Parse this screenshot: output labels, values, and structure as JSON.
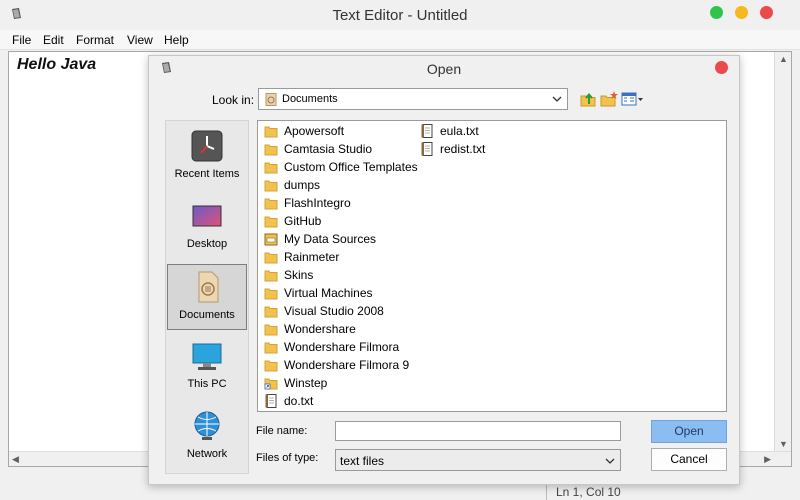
{
  "window": {
    "title": "Text Editor - Untitled"
  },
  "menu": [
    "File",
    "Edit",
    "Format",
    "View",
    "Help"
  ],
  "editor": {
    "content": "Hello Java"
  },
  "statusbar": {
    "text": "Ln 1, Col 10"
  },
  "dialog": {
    "title": "Open",
    "look_in_label": "Look in:",
    "look_in_value": "Documents",
    "places": [
      {
        "label": "Recent Items",
        "icon": "recent-items-icon",
        "selected": false
      },
      {
        "label": "Desktop",
        "icon": "desktop-icon",
        "selected": false
      },
      {
        "label": "Documents",
        "icon": "documents-icon",
        "selected": true
      },
      {
        "label": "This PC",
        "icon": "computer-icon",
        "selected": false
      },
      {
        "label": "Network",
        "icon": "network-icon",
        "selected": false
      }
    ],
    "files_col1": [
      {
        "name": "Apowersoft",
        "type": "folder"
      },
      {
        "name": "Camtasia Studio",
        "type": "folder"
      },
      {
        "name": "Custom Office Templates",
        "type": "folder"
      },
      {
        "name": "dumps",
        "type": "folder"
      },
      {
        "name": "FlashIntegro",
        "type": "folder"
      },
      {
        "name": "GitHub",
        "type": "folder"
      },
      {
        "name": "My Data Sources",
        "type": "datasource"
      },
      {
        "name": "Rainmeter",
        "type": "folder"
      },
      {
        "name": "Skins",
        "type": "folder"
      },
      {
        "name": "Virtual Machines",
        "type": "folder"
      },
      {
        "name": "Visual Studio 2008",
        "type": "folder"
      },
      {
        "name": "Wondershare",
        "type": "folder"
      },
      {
        "name": "Wondershare Filmora",
        "type": "folder"
      },
      {
        "name": "Wondershare Filmora 9",
        "type": "folder"
      },
      {
        "name": "Winstep",
        "type": "shortcut-folder"
      },
      {
        "name": "do.txt",
        "type": "text"
      }
    ],
    "files_col2": [
      {
        "name": "eula.txt",
        "type": "text"
      },
      {
        "name": "redist.txt",
        "type": "text"
      }
    ],
    "file_name_label": "File name:",
    "file_name_value": "",
    "file_type_label": "Files of type:",
    "file_type_value": "text files",
    "open_button": "Open",
    "cancel_button": "Cancel"
  },
  "colors": {
    "folder": "#f2c14e",
    "open_button": "#8bbcf2",
    "close_red": "#ec4a4a",
    "min_yellow": "#f5b91f",
    "max_green": "#2fc54a"
  }
}
